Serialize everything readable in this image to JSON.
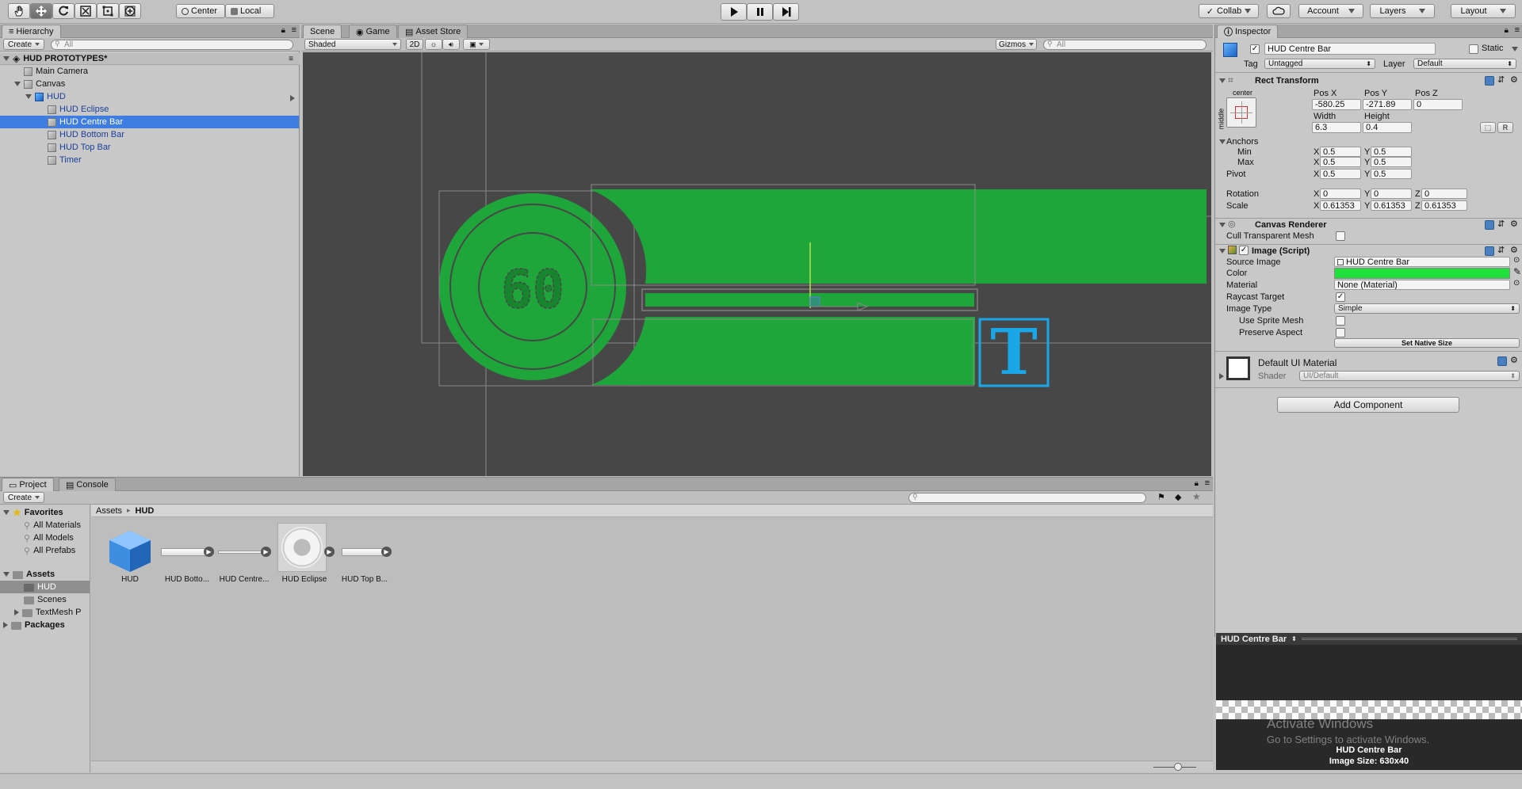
{
  "toolbar": {
    "tools": [
      "hand-tool-icon",
      "move-tool-icon",
      "rotate-tool-icon",
      "scale-tool-icon",
      "rect-tool-icon",
      "transform-tool-icon"
    ],
    "pivot_label": "Center",
    "space_label": "Local",
    "collab_label": "Collab",
    "account_label": "Account",
    "layers_label": "Layers",
    "layout_label": "Layout"
  },
  "hierarchy": {
    "tab": "Hierarchy",
    "create_label": "Create",
    "search_placeholder": "All",
    "scene_name": "HUD PROTOTYPES*",
    "items": [
      {
        "label": "Main Camera"
      },
      {
        "label": "Canvas"
      },
      {
        "label": "HUD"
      },
      {
        "label": "HUD Eclipse"
      },
      {
        "label": "HUD Centre Bar"
      },
      {
        "label": "HUD Bottom Bar"
      },
      {
        "label": "HUD Top Bar"
      },
      {
        "label": "Timer"
      }
    ]
  },
  "scene": {
    "tabs": [
      "Scene",
      "Game",
      "Asset Store"
    ],
    "shading_mode": "Shaded",
    "mode_2d": "2D",
    "gizmos_label": "Gizmos",
    "search_placeholder": "All",
    "hud_number": "60",
    "text_glyph": "T",
    "colors": {
      "hud_green": "#1ea63a",
      "text_blue": "#1aa7e8",
      "background": "#474747"
    }
  },
  "inspector": {
    "tab": "Inspector",
    "object_name": "HUD Centre Bar",
    "static_label": "Static",
    "tag_label": "Tag",
    "tag_value": "Untagged",
    "layer_label": "Layer",
    "layer_value": "Default",
    "rect_transform": {
      "title": "Rect Transform",
      "anchor_h": "center",
      "anchor_v": "middle",
      "pos_x_label": "Pos X",
      "pos_x": "-580.25",
      "pos_y_label": "Pos Y",
      "pos_y": "-271.89",
      "pos_z_label": "Pos Z",
      "pos_z": "0",
      "width_label": "Width",
      "width": "6.3",
      "height_label": "Height",
      "height": "0.4",
      "r_label": "R",
      "anchors_label": "Anchors",
      "min_label": "Min",
      "min_x": "0.5",
      "min_y": "0.5",
      "max_label": "Max",
      "max_x": "0.5",
      "max_y": "0.5",
      "pivot_label": "Pivot",
      "pivot_x": "0.5",
      "pivot_y": "0.5",
      "rotation_label": "Rotation",
      "rot_x": "0",
      "rot_y": "0",
      "rot_z": "0",
      "scale_label": "Scale",
      "scale_x": "0.61353",
      "scale_y": "0.61353",
      "scale_z": "0.61353",
      "x": "X",
      "y": "Y",
      "z": "Z"
    },
    "canvas_renderer": {
      "title": "Canvas Renderer",
      "cull_label": "Cull Transparent Mesh"
    },
    "image": {
      "title": "Image (Script)",
      "source_label": "Source Image",
      "source_value": "HUD Centre Bar",
      "color_label": "Color",
      "color_value": "#1ee13c",
      "material_label": "Material",
      "material_value": "None (Material)",
      "raycast_label": "Raycast Target",
      "image_type_label": "Image Type",
      "image_type_value": "Simple",
      "sprite_mesh_label": "Use Sprite Mesh",
      "preserve_label": "Preserve Aspect",
      "native_size_label": "Set Native Size"
    },
    "material": {
      "title": "Default UI Material",
      "shader_label": "Shader",
      "shader_value": "UI/Default"
    },
    "add_component_label": "Add Component",
    "preview": {
      "title": "HUD Centre Bar",
      "watermark_title": "Activate Windows",
      "watermark_sub": "Go to Settings to activate Windows.",
      "caption_name": "HUD Centre Bar",
      "caption_size": "Image Size: 630x40"
    }
  },
  "project": {
    "tabs": [
      "Project",
      "Console"
    ],
    "create_label": "Create",
    "favorites_label": "Favorites",
    "favorites": [
      "All Materials",
      "All Models",
      "All Prefabs"
    ],
    "assets_label": "Assets",
    "asset_folders": [
      "HUD",
      "Scenes",
      "TextMesh P"
    ],
    "packages_label": "Packages",
    "breadcrumb": [
      "Assets",
      "HUD"
    ],
    "assets": [
      {
        "label": "HUD"
      },
      {
        "label": "HUD Botto..."
      },
      {
        "label": "HUD Centre..."
      },
      {
        "label": "HUD Eclipse"
      },
      {
        "label": "HUD Top B..."
      }
    ]
  }
}
